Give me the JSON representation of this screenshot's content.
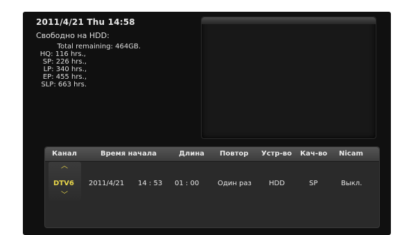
{
  "status": {
    "datetime": "2011/4/21 Thu 14:58",
    "hdd_title": "Свободно на HDD:",
    "lines": [
      "Total remaining: 464GB.",
      "HQ: 116 hrs.,",
      "SP: 226 hrs.,",
      "LP: 340 hrs.,",
      "EP: 455 hrs.,",
      "SLP: 663 hrs."
    ]
  },
  "table": {
    "headers": [
      "Канал",
      "Время начала",
      "Длина",
      "Повтор",
      "Устр-во",
      "Кач-во",
      "Nicam"
    ],
    "row": {
      "channel": "DTV6",
      "date": "2011/4/21",
      "start_time": "14 : 53",
      "length": "01 : 00",
      "repeat": "Один раз",
      "device": "HDD",
      "quality": "SP",
      "nicam": "Выкл."
    },
    "selector_color": "#e8d64a"
  }
}
